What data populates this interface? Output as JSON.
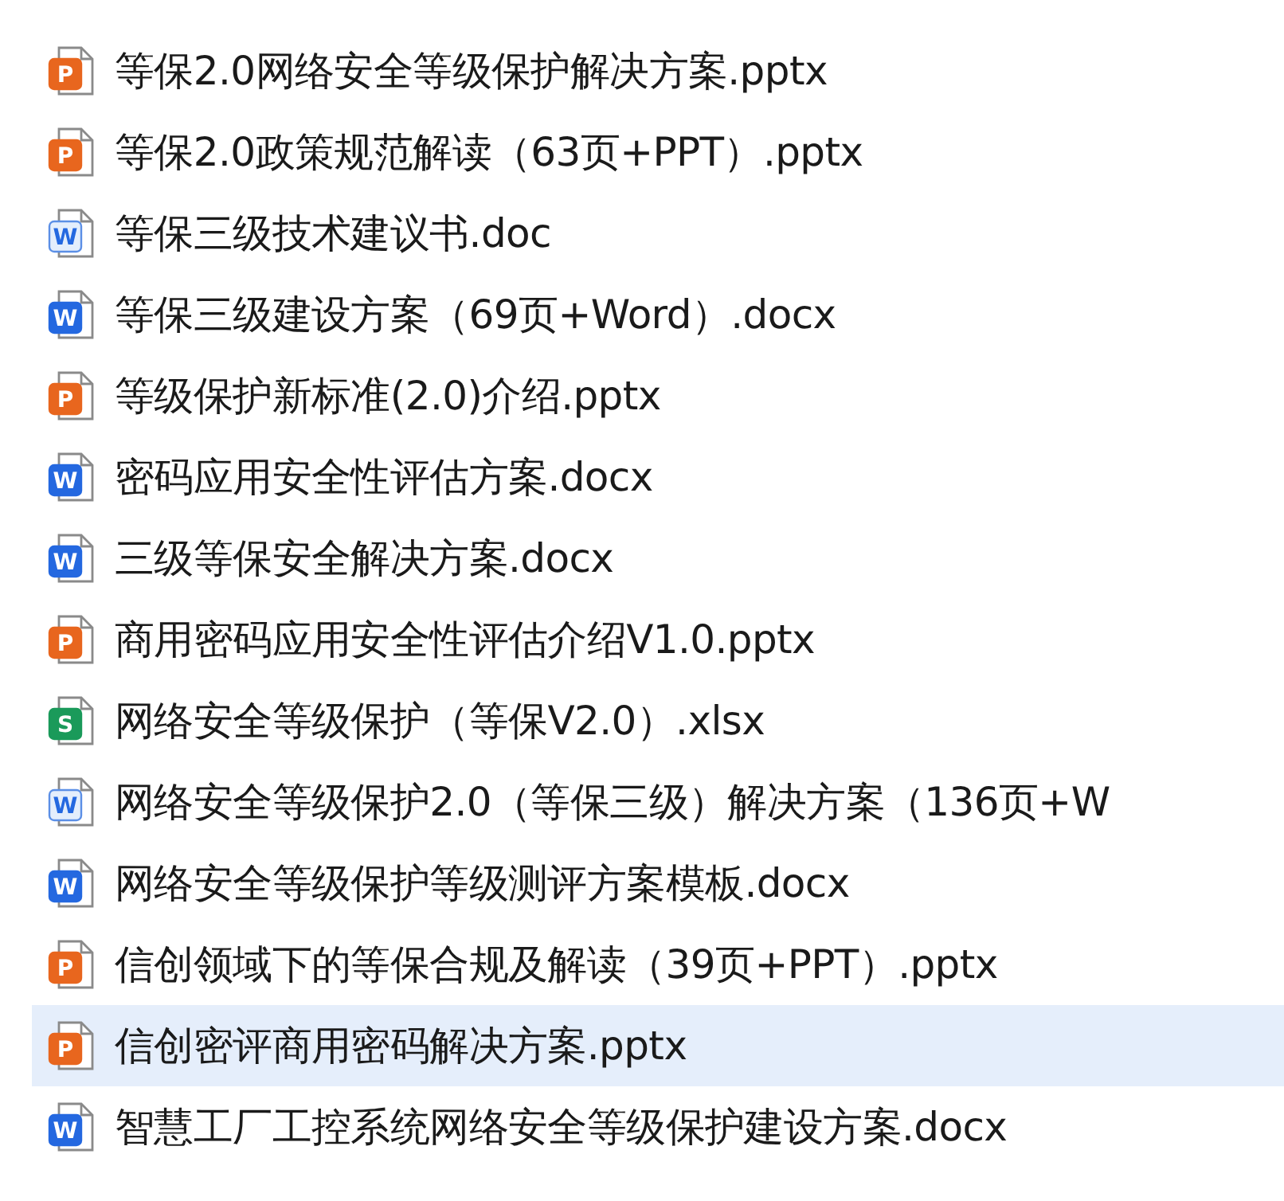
{
  "files": [
    {
      "name": "等保2.0网络安全等级保护解决方案.pptx",
      "kind": "pptx",
      "badge": "P",
      "selected": false
    },
    {
      "name": "等保2.0政策规范解读（63页+PPT）.pptx",
      "kind": "pptx",
      "badge": "P",
      "selected": false
    },
    {
      "name": "等保三级技术建议书.doc",
      "kind": "doc",
      "badge": "W",
      "selected": false
    },
    {
      "name": "等保三级建设方案（69页+Word）.docx",
      "kind": "docx",
      "badge": "W",
      "selected": false
    },
    {
      "name": "等级保护新标准(2.0)介绍.pptx",
      "kind": "pptx",
      "badge": "P",
      "selected": false
    },
    {
      "name": "密码应用安全性评估方案.docx",
      "kind": "docx",
      "badge": "W",
      "selected": false
    },
    {
      "name": "三级等保安全解决方案.docx",
      "kind": "docx",
      "badge": "W",
      "selected": false
    },
    {
      "name": "商用密码应用安全性评估介绍V1.0.pptx",
      "kind": "pptx",
      "badge": "P",
      "selected": false
    },
    {
      "name": "网络安全等级保护（等保V2.0）.xlsx",
      "kind": "xlsx",
      "badge": "S",
      "selected": false
    },
    {
      "name": "网络安全等级保护2.0（等保三级）解决方案（136页+W",
      "kind": "doc",
      "badge": "W",
      "selected": false
    },
    {
      "name": "网络安全等级保护等级测评方案模板.docx",
      "kind": "docx",
      "badge": "W",
      "selected": false
    },
    {
      "name": "信创领域下的等保合规及解读（39页+PPT）.pptx",
      "kind": "pptx",
      "badge": "P",
      "selected": false
    },
    {
      "name": "信创密评商用密码解决方案.pptx",
      "kind": "pptx",
      "badge": "P",
      "selected": true
    },
    {
      "name": "智慧工厂工控系统网络安全等级保护建设方案.docx",
      "kind": "docx",
      "badge": "W",
      "selected": false
    }
  ]
}
